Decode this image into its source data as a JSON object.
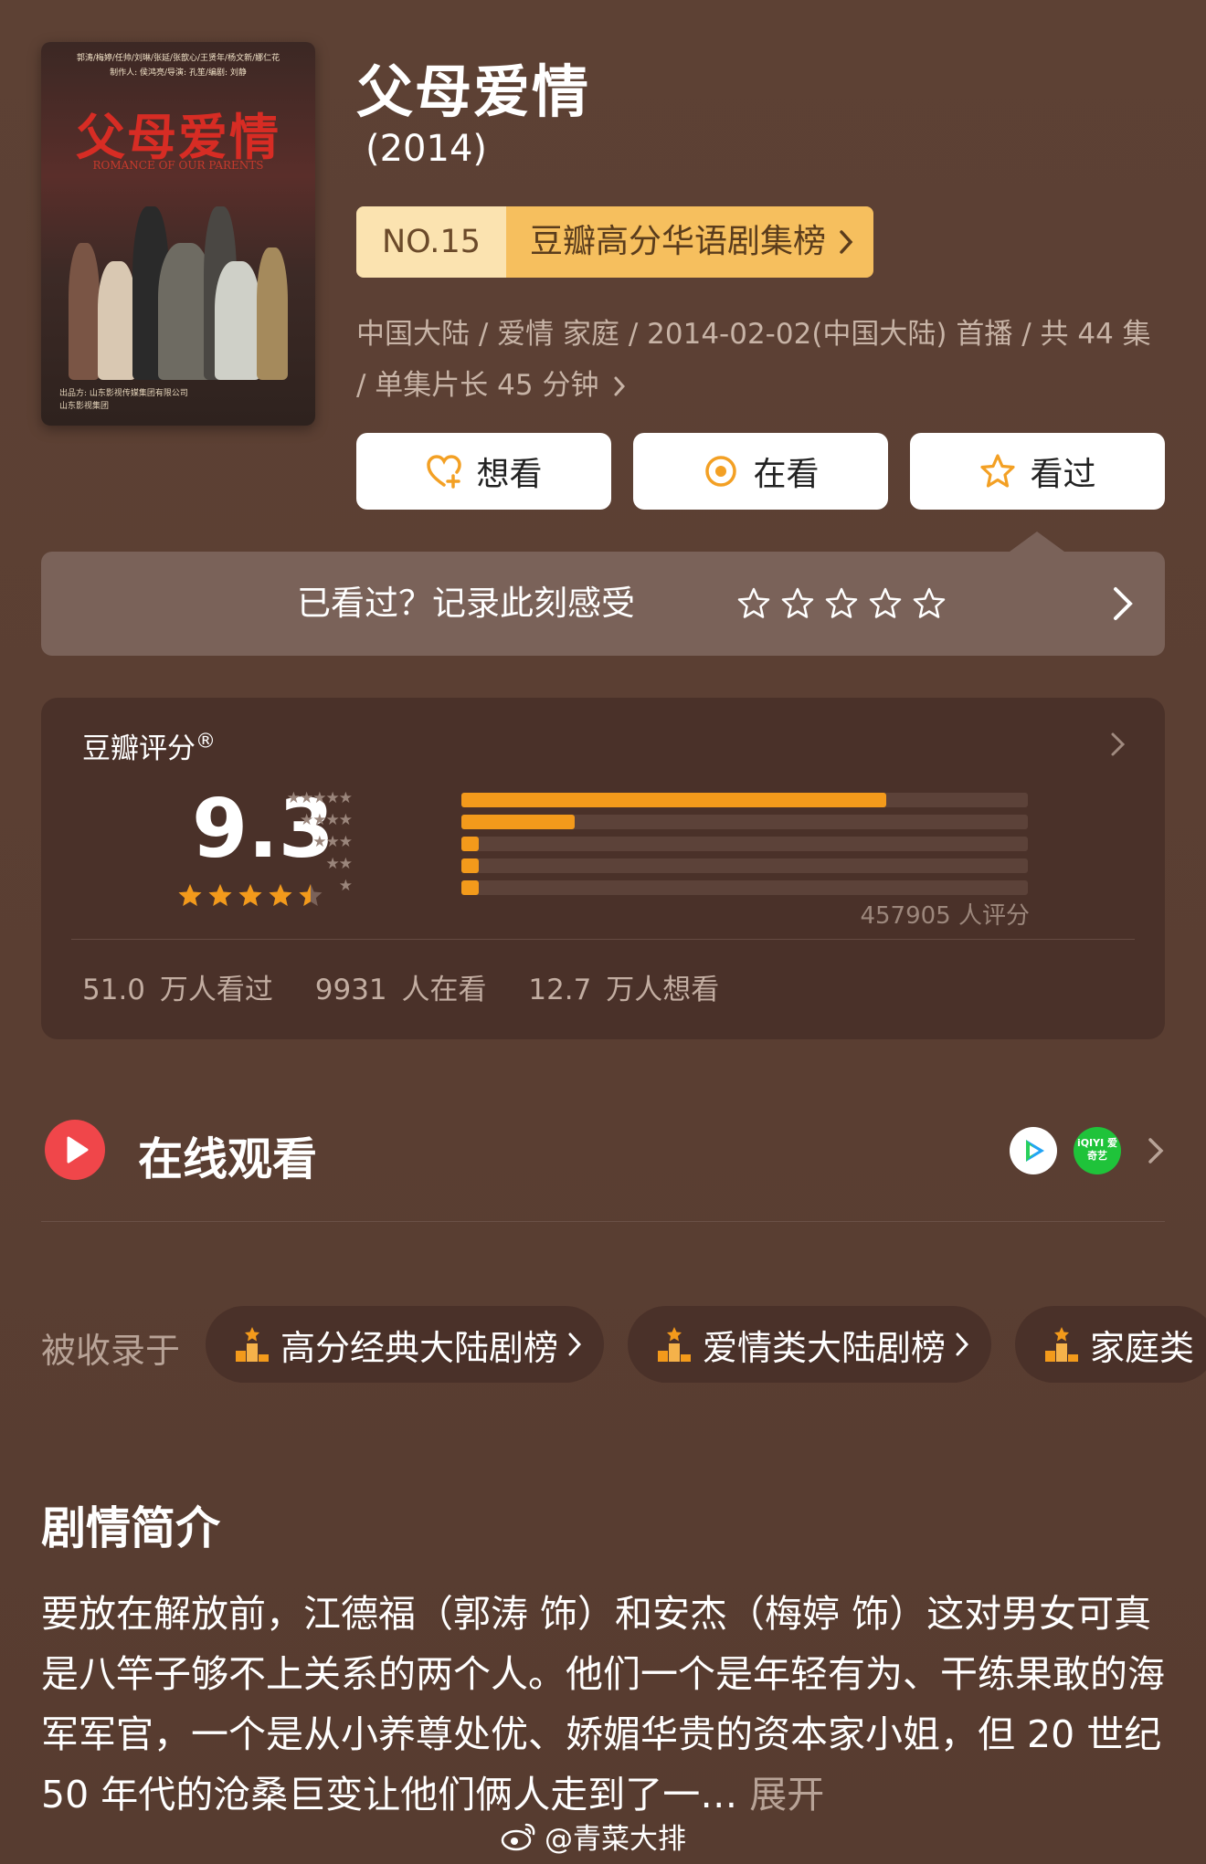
{
  "poster": {
    "credits_line1": "郭涛/梅婷/任帅/刘琳/张延/张歆心/王贤年/杨文新/娜仁花",
    "credits_line2": "制作人: 侯鸿亮/导演: 孔笙/编剧: 刘静",
    "title": "父母爱情",
    "subtitle": "ROMANCE OF OUR PARENTS",
    "footer_line1": "出品方: 山东影视传媒集团有限公司",
    "footer_line2": "山东影视集团"
  },
  "title": "父母爱情",
  "year": "(2014)",
  "rank": {
    "no": "NO.15",
    "name": "豆瓣高分华语剧集榜"
  },
  "meta": "中国大陆 / 爱情 家庭 / 2014-02-02(中国大陆) 首播 / 共 44 集 / 单集片长 45 分钟",
  "actions": [
    {
      "label": "想看",
      "icon": "heart-plus-icon"
    },
    {
      "label": "在看",
      "icon": "target-icon"
    },
    {
      "label": "看过",
      "icon": "star-icon"
    }
  ],
  "record": {
    "text": "已看过？记录此刻感受"
  },
  "rating": {
    "label": "豆瓣评分",
    "score": "9.3",
    "stars": 4.5,
    "distribution": [
      0.75,
      0.2,
      0.03,
      0.025,
      0.025
    ],
    "count_text": "457905 人评分",
    "stats": [
      "51.0 万人看过",
      "9931 人在看",
      "12.7 万人想看"
    ]
  },
  "online": {
    "title": "在线观看",
    "platform2": "iQIYI 爱奇艺"
  },
  "collected": {
    "title": "被收录于",
    "lists": [
      "高分经典大陆剧榜",
      "爱情类大陆剧榜",
      "家庭类"
    ]
  },
  "synopsis": {
    "title": "剧情简介",
    "text": "要放在解放前，江德福（郭涛 饰）和安杰（梅婷 饰）这对男女可真是八竿子够不上关系的两个人。他们一个是年轻有为、干练果敢的海军军官，一个是从小养尊处优、娇媚华贵的资本家小姐，但 20 世纪 50 年代的沧桑巨变让他们俩人走到了一…",
    "more": "展开"
  },
  "watermark": "@青菜大排",
  "colors": {
    "accent": "#f39a1b",
    "background": "#5a3f33",
    "card": "#4a3129"
  }
}
